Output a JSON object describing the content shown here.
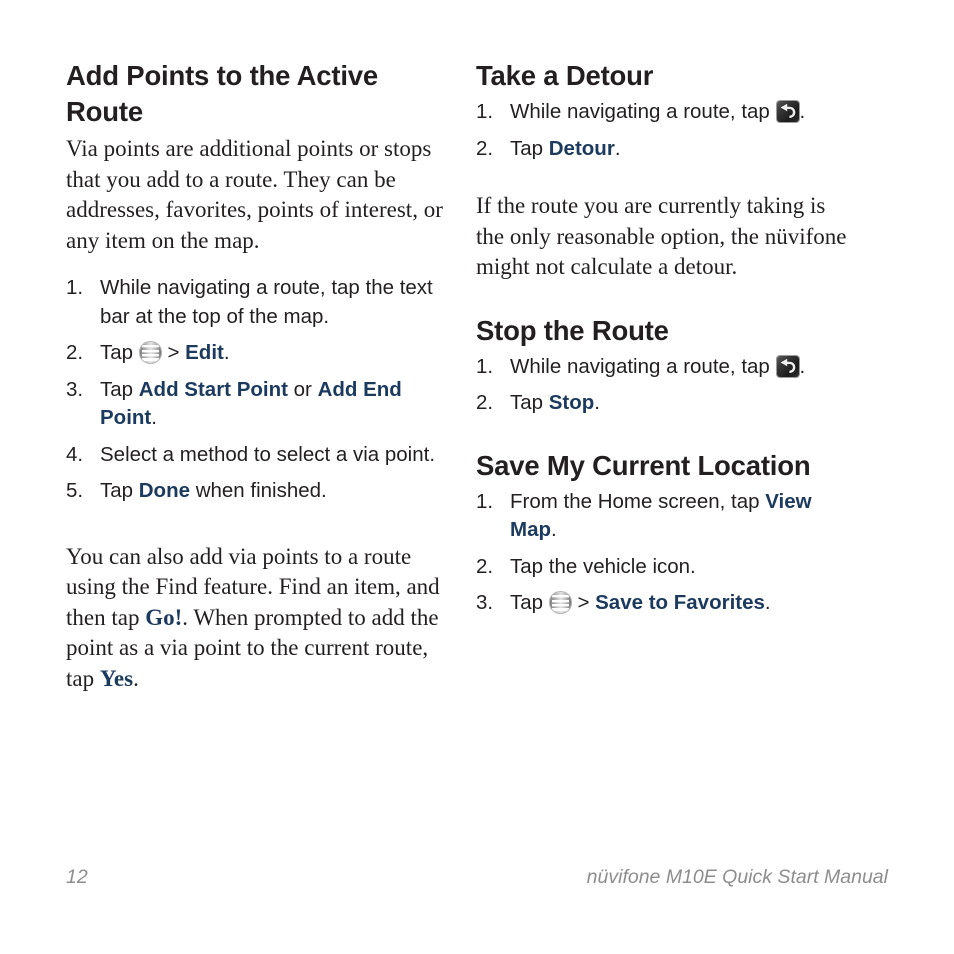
{
  "document": {
    "page_number": "12",
    "footer_title": "nüvifone M10E Quick Start Manual",
    "accent_color": "#1b3a5e",
    "text_color": "#231f20",
    "footer_color": "#8d8d8d"
  },
  "left_column": {
    "heading": "Add Points to the Active Route",
    "intro_paragraph": "Via points are additional points or stops that you add to a route. They can be addresses, favorites, points of interest, or any item on the map.",
    "steps": [
      {
        "num": "1.",
        "parts": [
          {
            "type": "text",
            "value": "While navigating a route, tap the text bar at the top of the map."
          }
        ]
      },
      {
        "num": "2.",
        "parts": [
          {
            "type": "text",
            "value": "Tap "
          },
          {
            "type": "icon",
            "value": "menu-icon"
          },
          {
            "type": "text",
            "value": " > "
          },
          {
            "type": "ui",
            "value": "Edit"
          },
          {
            "type": "text",
            "value": "."
          }
        ]
      },
      {
        "num": "3.",
        "parts": [
          {
            "type": "text",
            "value": "Tap "
          },
          {
            "type": "ui",
            "value": "Add Start Point"
          },
          {
            "type": "text",
            "value": " or "
          },
          {
            "type": "ui",
            "value": "Add End Point"
          },
          {
            "type": "text",
            "value": "."
          }
        ]
      },
      {
        "num": "4.",
        "parts": [
          {
            "type": "text",
            "value": "Select a method to select a via point."
          }
        ]
      },
      {
        "num": "5.",
        "parts": [
          {
            "type": "text",
            "value": "Tap "
          },
          {
            "type": "ui",
            "value": "Done"
          },
          {
            "type": "text",
            "value": " when finished."
          }
        ]
      }
    ],
    "closing_paragraph": {
      "part1": "You can also add via points to a route using the Find feature. Find an item, and then tap ",
      "term1": "Go!",
      "part2": ". When prompted to add the point as a via point to the current route, tap ",
      "term2": "Yes",
      "part3": "."
    }
  },
  "right_column": {
    "sections": [
      {
        "heading": "Take a Detour",
        "steps": [
          {
            "num": "1.",
            "parts": [
              {
                "type": "text",
                "value": "While navigating a route, tap "
              },
              {
                "type": "icon",
                "value": "detour-icon"
              },
              {
                "type": "text",
                "value": "."
              }
            ]
          },
          {
            "num": "2.",
            "parts": [
              {
                "type": "text",
                "value": "Tap "
              },
              {
                "type": "ui",
                "value": "Detour"
              },
              {
                "type": "text",
                "value": "."
              }
            ]
          }
        ],
        "note": "If the route you are currently taking is the only reasonable option, the nüvifone might not calculate a detour."
      },
      {
        "heading": "Stop the Route",
        "steps": [
          {
            "num": "1.",
            "parts": [
              {
                "type": "text",
                "value": "While navigating a route, tap "
              },
              {
                "type": "icon",
                "value": "detour-icon"
              },
              {
                "type": "text",
                "value": "."
              }
            ]
          },
          {
            "num": "2.",
            "parts": [
              {
                "type": "text",
                "value": "Tap "
              },
              {
                "type": "ui",
                "value": "Stop"
              },
              {
                "type": "text",
                "value": "."
              }
            ]
          }
        ],
        "note": ""
      },
      {
        "heading": "Save My Current Location",
        "steps": [
          {
            "num": "1.",
            "parts": [
              {
                "type": "text",
                "value": "From the Home screen, tap "
              },
              {
                "type": "ui",
                "value": "View Map"
              },
              {
                "type": "text",
                "value": "."
              }
            ]
          },
          {
            "num": "2.",
            "parts": [
              {
                "type": "text",
                "value": "Tap the vehicle icon."
              }
            ]
          },
          {
            "num": "3.",
            "parts": [
              {
                "type": "text",
                "value": "Tap "
              },
              {
                "type": "icon",
                "value": "menu-icon"
              },
              {
                "type": "text",
                "value": " > "
              },
              {
                "type": "ui",
                "value": "Save to Favorites"
              },
              {
                "type": "text",
                "value": "."
              }
            ]
          }
        ],
        "note": ""
      }
    ]
  }
}
